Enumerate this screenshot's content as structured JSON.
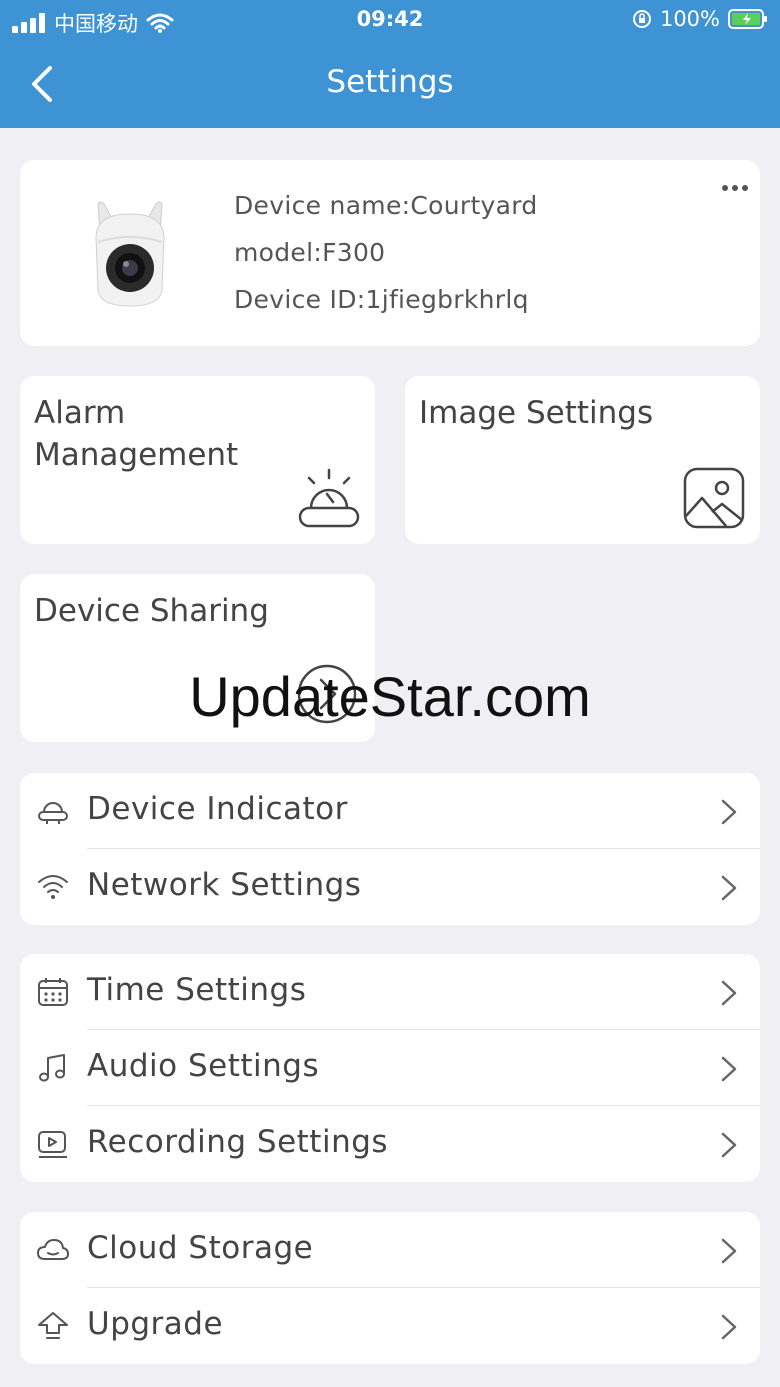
{
  "status_bar": {
    "carrier": "中国移动",
    "time": "09:42",
    "battery": "100%"
  },
  "nav": {
    "title": "Settings"
  },
  "device": {
    "name_line": "Device name:Courtyard",
    "model_line": "model:F300",
    "id_line": "Device ID:1jfiegbrkhrlq"
  },
  "tiles": {
    "alarm": "Alarm Management",
    "image": "Image Settings",
    "sharing": "Device Sharing"
  },
  "group1": {
    "device_indicator": "Device Indicator",
    "network_settings": "Network Settings"
  },
  "group2": {
    "time_settings": "Time Settings",
    "audio_settings": "Audio Settings",
    "recording_settings": "Recording Settings"
  },
  "group3": {
    "cloud_storage": "Cloud Storage",
    "upgrade": "Upgrade"
  },
  "watermark": "UpdateStar.com",
  "colors": {
    "header": "#3d93d3",
    "background": "#efeff4",
    "card": "#ffffff",
    "text": "#444444"
  }
}
